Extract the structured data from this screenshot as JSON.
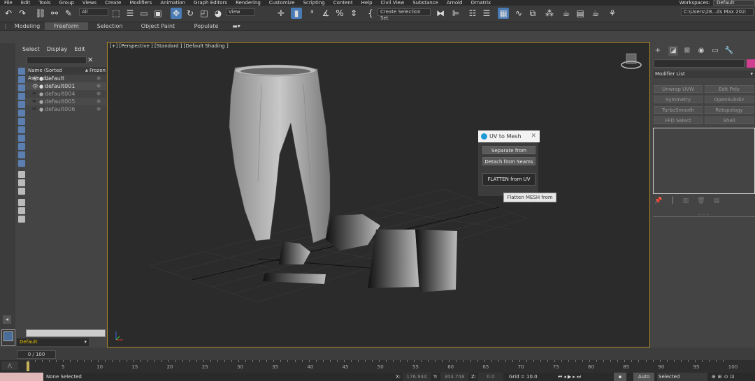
{
  "menu": [
    "File",
    "Edit",
    "Tools",
    "Group",
    "Views",
    "Create",
    "Modifiers",
    "Animation",
    "Graph Editors",
    "Rendering",
    "Customize",
    "Scripting",
    "Content",
    "Help",
    "Civil View",
    "Substance",
    "Arnold",
    "Ornatrix"
  ],
  "workspace": {
    "label": "Workspaces:",
    "value": "Default"
  },
  "toolbar": {
    "filter": "All",
    "view": "View",
    "selection_set": "Create Selection Set",
    "path": "C:\\Users\\28...ds Max 202:"
  },
  "ribbon": {
    "tabs": [
      "Modeling",
      "Freeform",
      "Selection",
      "Object Paint",
      "Populate"
    ],
    "active": "Freeform"
  },
  "scene_explorer": {
    "menu": [
      "Select",
      "Display",
      "Edit"
    ],
    "header": {
      "name": "Name (Sorted Ascend...",
      "sort": "▲",
      "frozen": "Frozen"
    },
    "items": [
      {
        "name": "default",
        "visible": true
      },
      {
        "name": "default001",
        "visible": true
      },
      {
        "name": "default004",
        "visible": false
      },
      {
        "name": "default005",
        "visible": false
      },
      {
        "name": "default006",
        "visible": false
      }
    ]
  },
  "viewport": {
    "label": "[+] [Perspective ] [Standard ] [Default Shading ]"
  },
  "uv_dialog": {
    "title": "UV to Mesh",
    "btn1": "Separate  from  Seams",
    "btn2": "Detach  from  Seams",
    "btn3": "FLATTEN  from  UV",
    "tooltip": "Flatten MESH from UV"
  },
  "command_panel": {
    "modifier_list": "Modifier List",
    "buttons": [
      "Unwrap UVW",
      "Edit Poly",
      "Symmetry",
      "OpenSubdiv",
      "TurboSmooth",
      "Retopology",
      "FFD Select",
      "Shell"
    ]
  },
  "layer": {
    "name": "Default"
  },
  "time": {
    "slider": "0 / 100",
    "ticks": [
      "5",
      "10",
      "15",
      "20",
      "25",
      "30",
      "35",
      "40",
      "45",
      "50",
      "55",
      "60",
      "65",
      "70",
      "75",
      "80",
      "85",
      "90",
      "95",
      "100"
    ]
  },
  "status": {
    "message": "None Selected",
    "x_label": "X:",
    "x": "176.944",
    "y_label": "Y:",
    "y": "304.748",
    "z_label": "Z:",
    "z": "0.0",
    "grid": "Grid = 10.0",
    "auto": "Auto",
    "selected": "Selected"
  }
}
